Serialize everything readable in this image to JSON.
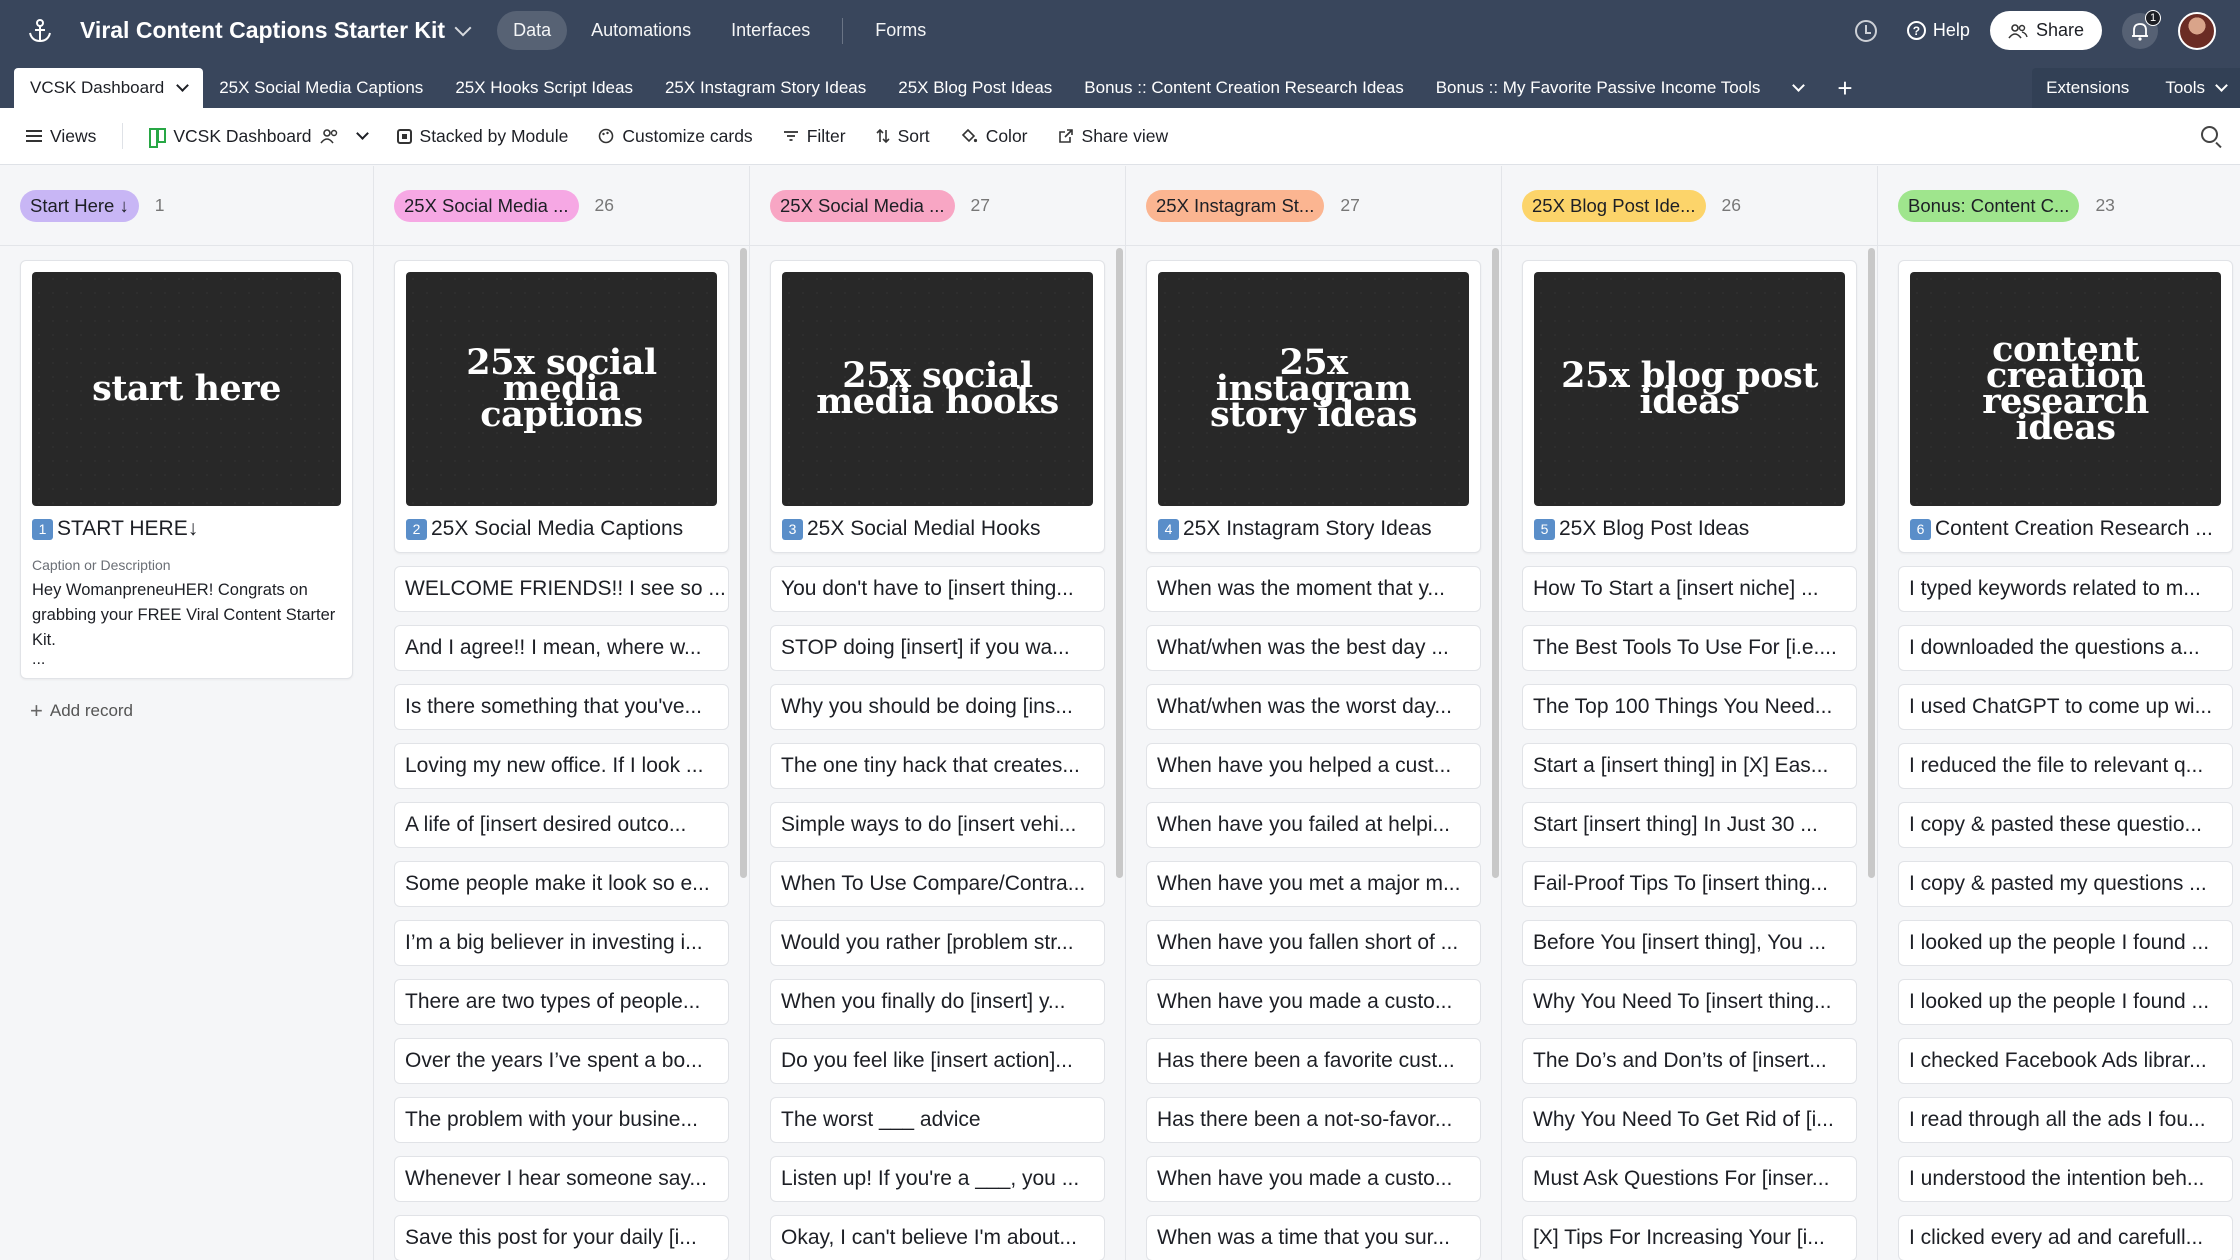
{
  "app": {
    "base_name": "Viral Content Captions Starter Kit",
    "nav": [
      "Data",
      "Automations",
      "Interfaces",
      "Forms"
    ],
    "help_label": "Help",
    "share_label": "Share",
    "notification_count": "1"
  },
  "tabs": {
    "active": "VCSK Dashboard",
    "items": [
      "25X Social Media Captions",
      "25X Hooks Script Ideas",
      "25X Instagram Story Ideas",
      "25X Blog Post Ideas",
      "Bonus :: Content Creation Research Ideas",
      "Bonus :: My Favorite Passive Income Tools"
    ],
    "extensions_label": "Extensions",
    "tools_label": "Tools"
  },
  "viewbar": {
    "views_label": "Views",
    "view_name": "VCSK Dashboard",
    "stacked_label": "Stacked by Module",
    "customize_label": "Customize cards",
    "filter_label": "Filter",
    "sort_label": "Sort",
    "color_label": "Color",
    "share_view_label": "Share view"
  },
  "colors": {
    "header_bg": "#39465c",
    "pill_start": "#c8b6f5",
    "pill_captions": "#f6a8e4",
    "pill_hooks": "#f8a6c4",
    "pill_instagram": "#fbb591",
    "pill_blog": "#fcd46a",
    "pill_bonus": "#9fe58d"
  },
  "columns": [
    {
      "name": "Start Here ↓",
      "count": "1",
      "cover": "start here",
      "badge": "1",
      "title": "START HERE↓",
      "field_label": "Caption or Description",
      "field_value": "Hey WomanpreneuHER! Congrats on grabbing your FREE Viral Content Starter Kit.",
      "field_more": "...",
      "add_record": "Add record"
    },
    {
      "name": "25X Social Media ...",
      "count": "26",
      "cover": "25x social media captions",
      "badge": "2",
      "title": "25X Social Media Captions",
      "records": [
        "WELCOME FRIENDS!! I see so ...",
        "And I agree!! I mean, where w...",
        "Is there something that you've...",
        "Loving my new office. If I look ...",
        "A life of [insert desired outco...",
        "Some people make it look so e...",
        "I’m a big believer in investing i...",
        "There are two types of people...",
        "Over the years I’ve spent a bo...",
        "The problem with your busine...",
        "Whenever I hear someone say...",
        "Save this post for your daily [i..."
      ]
    },
    {
      "name": "25X Social Media ...",
      "count": "27",
      "cover": "25x social media hooks",
      "badge": "3",
      "title": "25X Social Medial Hooks",
      "records": [
        "You don't have to [insert thing...",
        "STOP doing [insert] if you wa...",
        "Why you should be doing [ins...",
        "The one tiny hack that creates...",
        "Simple ways to do [insert vehi...",
        "When To Use Compare/Contra...",
        "Would you rather [problem str...",
        "When you finally do [insert] y...",
        "Do you feel like [insert action]...",
        "The worst ___ advice",
        "Listen up! If you're a ___, you ...",
        "Okay, I can't believe I'm about..."
      ]
    },
    {
      "name": "25X Instagram St...",
      "count": "27",
      "cover": "25x instagram story ideas",
      "badge": "4",
      "title": "25X Instagram Story Ideas",
      "records": [
        "When was the moment that y...",
        "What/when was the best day ...",
        "What/when was the worst day...",
        "When have you helped a cust...",
        "When have you failed at helpi...",
        "When have you met a major m...",
        "When have you fallen short of ...",
        "When have you made a custo...",
        "Has there been a favorite cust...",
        "Has there been a not-so-favor...",
        "When have you made a custo...",
        "When was a time that you sur..."
      ]
    },
    {
      "name": "25X Blog Post Ide...",
      "count": "26",
      "cover": "25x blog post ideas",
      "badge": "5",
      "title": "25X Blog Post Ideas",
      "records": [
        "How To Start a [insert niche] ...",
        "The Best Tools To Use For [i.e....",
        "The Top 100 Things You Need...",
        "Start a [insert thing] in [X] Eas...",
        "Start [insert thing] In Just 30 ...",
        "Fail-Proof Tips To [insert thing...",
        "Before You [insert thing], You ...",
        "Why You Need To [insert thing...",
        "The Do’s and Don’ts of [insert...",
        "Why You Need To Get Rid of [i...",
        "Must Ask Questions For [inser...",
        "[X] Tips For Increasing Your [i..."
      ]
    },
    {
      "name": "Bonus: Content C...",
      "count": "23",
      "cover": "content creation research ideas",
      "badge": "6",
      "title": "Content Creation Research ...",
      "records": [
        "I typed keywords related to m...",
        "I downloaded the questions a...",
        "I used ChatGPT to come up wi...",
        "I reduced the file to relevant q...",
        "I copy & pasted these questio...",
        "I copy & pasted my questions ...",
        "I looked up the people I found ...",
        "I looked up the people I found ...",
        "I checked Facebook Ads librar...",
        "I read through all the ads I fou...",
        "I understood the intention beh...",
        "I clicked every ad and carefull..."
      ]
    }
  ]
}
